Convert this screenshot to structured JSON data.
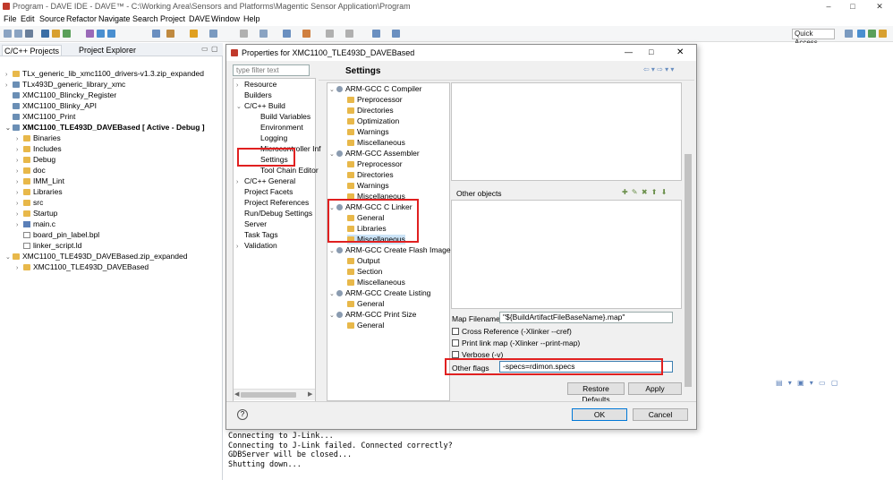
{
  "window": {
    "title": "Program - DAVE IDE - DAVE™ - C:\\Working Area\\Sensors and Platforms\\Magentic Sensor Application\\Program",
    "controls": [
      "–",
      "□",
      "✕"
    ]
  },
  "menu": [
    "File",
    "Edit",
    "Source",
    "Refactor",
    "Navigate",
    "Search",
    "Project",
    "DAVE",
    "Window",
    "Help"
  ],
  "toolbar": {
    "quick_access": "Quick Access"
  },
  "left_panel": {
    "tabs": [
      "C/C++ Projects",
      "Project Explorer"
    ],
    "tree": [
      {
        "label": "TLx_generic_lib_xmc1100_drivers-v1.3.zip_expanded",
        "indent": 0,
        "arrow": ">",
        "icon": "folder",
        "bold": false
      },
      {
        "label": "TLx493D_generic_library_xmc",
        "indent": 0,
        "arrow": ">",
        "icon": "proj",
        "bold": false
      },
      {
        "label": "XMC1100_Blincky_Register",
        "indent": 0,
        "arrow": "",
        "icon": "proj",
        "bold": false
      },
      {
        "label": "XMC1100_Blinky_API",
        "indent": 0,
        "arrow": "",
        "icon": "proj",
        "bold": false
      },
      {
        "label": "XMC1100_Print",
        "indent": 0,
        "arrow": "",
        "icon": "proj",
        "bold": false
      },
      {
        "label": "XMC1100_TLE493D_DAVEBased  [ Active - Debug ]",
        "indent": 0,
        "arrow": "v",
        "icon": "proj",
        "bold": true
      },
      {
        "label": "Binaries",
        "indent": 1,
        "arrow": ">",
        "icon": "folder",
        "bold": false
      },
      {
        "label": "Includes",
        "indent": 1,
        "arrow": ">",
        "icon": "folder",
        "bold": false
      },
      {
        "label": "Debug",
        "indent": 1,
        "arrow": ">",
        "icon": "folder",
        "bold": false
      },
      {
        "label": "doc",
        "indent": 1,
        "arrow": ">",
        "icon": "folder",
        "bold": false
      },
      {
        "label": "IMM_Lint",
        "indent": 1,
        "arrow": ">",
        "icon": "folder",
        "bold": false
      },
      {
        "label": "Libraries",
        "indent": 1,
        "arrow": ">",
        "icon": "folder",
        "bold": false
      },
      {
        "label": "src",
        "indent": 1,
        "arrow": ">",
        "icon": "folder",
        "bold": false
      },
      {
        "label": "Startup",
        "indent": 1,
        "arrow": ">",
        "icon": "folder",
        "bold": false
      },
      {
        "label": "main.c",
        "indent": 1,
        "arrow": ">",
        "icon": "cfile",
        "bold": false
      },
      {
        "label": "board_pin_label.bpl",
        "indent": 1,
        "arrow": "",
        "icon": "file",
        "bold": false
      },
      {
        "label": "linker_script.ld",
        "indent": 1,
        "arrow": "",
        "icon": "file",
        "bold": false
      },
      {
        "label": "XMC1100_TLE493D_DAVEBased.zip_expanded",
        "indent": 0,
        "arrow": "v",
        "icon": "folder",
        "bold": false
      },
      {
        "label": "XMC1100_TLE493D_DAVEBased",
        "indent": 1,
        "arrow": ">",
        "icon": "folder",
        "bold": false
      }
    ]
  },
  "dialog": {
    "title": "Properties for XMC1100_TLE493D_DAVEBased",
    "filter_placeholder": "type filter text",
    "categories": [
      {
        "label": "Resource",
        "indent": 0,
        "arrow": ">"
      },
      {
        "label": "Builders",
        "indent": 0,
        "arrow": ""
      },
      {
        "label": "C/C++ Build",
        "indent": 0,
        "arrow": "v"
      },
      {
        "label": "Build Variables",
        "indent": 1,
        "arrow": ""
      },
      {
        "label": "Environment",
        "indent": 1,
        "arrow": ""
      },
      {
        "label": "Logging",
        "indent": 1,
        "arrow": ""
      },
      {
        "label": "Microcontroller Inf",
        "indent": 1,
        "arrow": ""
      },
      {
        "label": "Settings",
        "indent": 1,
        "arrow": ""
      },
      {
        "label": "Tool Chain Editor",
        "indent": 1,
        "arrow": ""
      },
      {
        "label": "C/C++ General",
        "indent": 0,
        "arrow": ">"
      },
      {
        "label": "Project Facets",
        "indent": 0,
        "arrow": ""
      },
      {
        "label": "Project References",
        "indent": 0,
        "arrow": ""
      },
      {
        "label": "Run/Debug Settings",
        "indent": 0,
        "arrow": ""
      },
      {
        "label": "Server",
        "indent": 0,
        "arrow": ""
      },
      {
        "label": "Task Tags",
        "indent": 0,
        "arrow": ""
      },
      {
        "label": "Validation",
        "indent": 0,
        "arrow": ">"
      }
    ],
    "settings_title": "Settings",
    "settings_tree": [
      {
        "label": "ARM-GCC C Compiler",
        "level": 0
      },
      {
        "label": "Preprocessor",
        "level": 1
      },
      {
        "label": "Directories",
        "level": 1
      },
      {
        "label": "Optimization",
        "level": 1
      },
      {
        "label": "Warnings",
        "level": 1
      },
      {
        "label": "Miscellaneous",
        "level": 1
      },
      {
        "label": "ARM-GCC Assembler",
        "level": 0
      },
      {
        "label": "Preprocessor",
        "level": 1
      },
      {
        "label": "Directories",
        "level": 1
      },
      {
        "label": "Warnings",
        "level": 1
      },
      {
        "label": "Miscellaneous",
        "level": 1
      },
      {
        "label": "ARM-GCC C Linker",
        "level": 0
      },
      {
        "label": "General",
        "level": 1
      },
      {
        "label": "Libraries",
        "level": 1
      },
      {
        "label": "Miscellaneous",
        "level": 1,
        "selected": true
      },
      {
        "label": "ARM-GCC Create Flash Image",
        "level": 0
      },
      {
        "label": "Output",
        "level": 1
      },
      {
        "label": "Section",
        "level": 1
      },
      {
        "label": "Miscellaneous",
        "level": 1
      },
      {
        "label": "ARM-GCC Create Listing",
        "level": 0
      },
      {
        "label": "General",
        "level": 1
      },
      {
        "label": "ARM-GCC Print Size",
        "level": 0
      },
      {
        "label": "General",
        "level": 1
      }
    ],
    "other_objects_label": "Other objects",
    "map_filename_label": "Map Filename",
    "map_filename_value": "\"${BuildArtifactFileBaseName}.map\"",
    "checkboxes": [
      "Cross Reference (-Xlinker --cref)",
      "Print link map (-Xlinker --print-map)",
      "Verbose (-v)"
    ],
    "other_flags_label": "Other flags",
    "other_flags_value": "-specs=rdimon.specs",
    "restore_defaults": "Restore Defaults",
    "apply": "Apply",
    "ok": "OK",
    "cancel": "Cancel",
    "help": "?"
  },
  "console": {
    "lines": [
      "Connecting to J-Link...",
      "Connecting to J-Link failed. Connected correctly?",
      "GDBServer will be closed...",
      "Shutting down..."
    ]
  },
  "colors": {
    "highlight_box": "#e02020",
    "selection": "#cce4f7",
    "accent": "#0078d7"
  }
}
